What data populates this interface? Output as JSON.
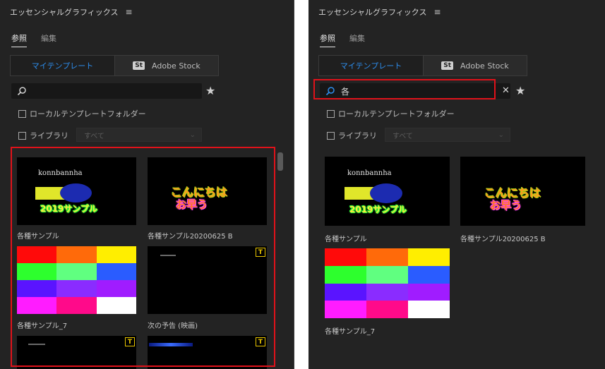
{
  "panel_title": "エッセンシャルグラフィックス",
  "tabs": {
    "browse": "参照",
    "edit": "編集"
  },
  "segments": {
    "my_templates": "マイテンプレート",
    "stock_badge": "St",
    "adobe_stock": "Adobe Stock"
  },
  "left": {
    "search_value": ""
  },
  "right": {
    "search_value": "各"
  },
  "local_folder_label": "ローカルテンプレートフォルダー",
  "library_label": "ライブラリ",
  "library_select_value": "すべて",
  "templates": [
    {
      "caption": "各種サンプル",
      "thumb_text_1": "konnbannha",
      "thumb_text_2": "2019サンプル"
    },
    {
      "caption": "各種サンプル20200625 B",
      "thumb_text_1": "こんにちは",
      "thumb_text_2": "お早う"
    },
    {
      "caption": "各種サンプル_7"
    },
    {
      "caption": "次の予告 (映画)",
      "badge": "T"
    },
    {
      "badge": "T"
    },
    {
      "badge": "T"
    }
  ],
  "colors": {
    "accent": "#2d8ceb",
    "highlight": "#e0121a",
    "grid": [
      "#ff0a0a",
      "#ff6a0a",
      "#ffee00",
      "#2dff2d",
      "#60ff80",
      "#2a5cff",
      "#5a14ff",
      "#8a2cff",
      "#a01cff",
      "#ff1cff",
      "#ff0a8a",
      "#ffffff"
    ]
  }
}
